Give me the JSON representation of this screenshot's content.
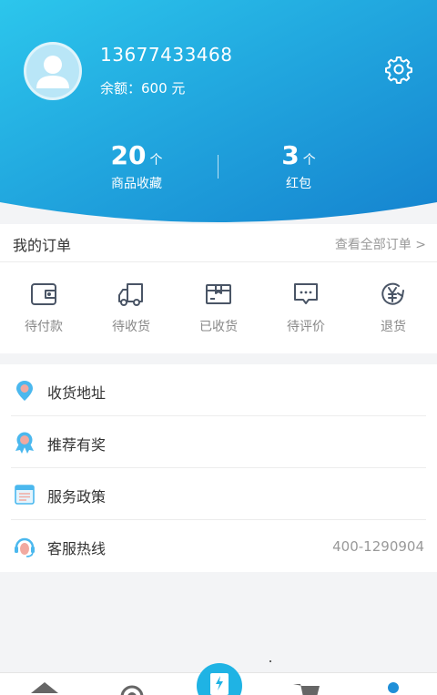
{
  "user": {
    "phone": "13677433468",
    "balance": "余额：600 元"
  },
  "stats": [
    {
      "num": "20",
      "unit": "个",
      "label": "商品收藏"
    },
    {
      "num": "3",
      "unit": "个",
      "label": "红包"
    }
  ],
  "orders": {
    "title": "我的订单",
    "view_all": "查看全部订单 >",
    "items": [
      {
        "label": "待付款",
        "icon": "wallet-icon"
      },
      {
        "label": "待收货",
        "icon": "truck-icon"
      },
      {
        "label": "已收货",
        "icon": "box-icon"
      },
      {
        "label": "待评价",
        "icon": "comment-icon"
      },
      {
        "label": "退货",
        "icon": "yen-return-icon"
      }
    ]
  },
  "menu": [
    {
      "label": "收货地址",
      "icon": "location-pin-icon"
    },
    {
      "label": "推荐有奖",
      "icon": "award-ribbon-icon"
    },
    {
      "label": "服务政策",
      "icon": "document-icon"
    },
    {
      "label": "客服热线",
      "icon": "headset-icon",
      "value": "400-1290904"
    }
  ],
  "colors": {
    "header_top": "#2cc3ea",
    "header_bottom": "#1485cf",
    "icon_accent": "#4bb8ee",
    "icon_pink": "#f1a9a0"
  }
}
